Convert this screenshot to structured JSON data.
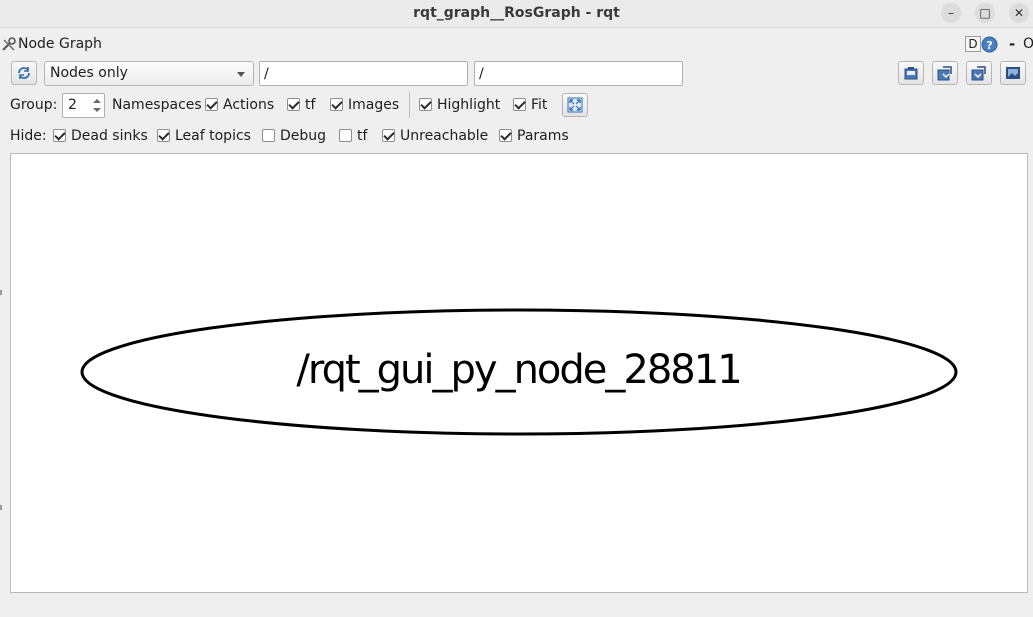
{
  "window": {
    "title": "rqt_graph__RosGraph - rqt",
    "minimize_label": "–",
    "maximize_label": "□",
    "close_label": "✕"
  },
  "dock": {
    "title": "Node Graph",
    "d_label": "D",
    "minus_label": "-",
    "o_label": "O"
  },
  "toolbar": {
    "refresh_icon": "refresh-icon",
    "display_mode": "Nodes only",
    "node_filter": "/",
    "topic_filter": "/",
    "actions_icons": [
      "load-dot-icon",
      "save-dot-icon",
      "save-svg-icon",
      "save-image-icon"
    ]
  },
  "options": {
    "group_label": "Group:",
    "group_value": "2",
    "namespaces_label": "Namespaces",
    "actions_label": "Actions",
    "actions_checked": true,
    "tf_label": "tf",
    "tf_checked": true,
    "images_label": "Images",
    "images_checked": true,
    "highlight_label": "Highlight",
    "highlight_checked": true,
    "fit_label": "Fit",
    "fit_checked": true
  },
  "hide": {
    "label": "Hide:",
    "dead_sinks_label": "Dead sinks",
    "dead_sinks_checked": true,
    "leaf_topics_label": "Leaf topics",
    "leaf_topics_checked": true,
    "debug_label": "Debug",
    "debug_checked": false,
    "tf_label": "tf",
    "tf_checked": false,
    "unreachable_label": "Unreachable",
    "unreachable_checked": true,
    "params_label": "Params",
    "params_checked": true
  },
  "graph": {
    "node_name": "/rqt_gui_py_node_28811"
  }
}
